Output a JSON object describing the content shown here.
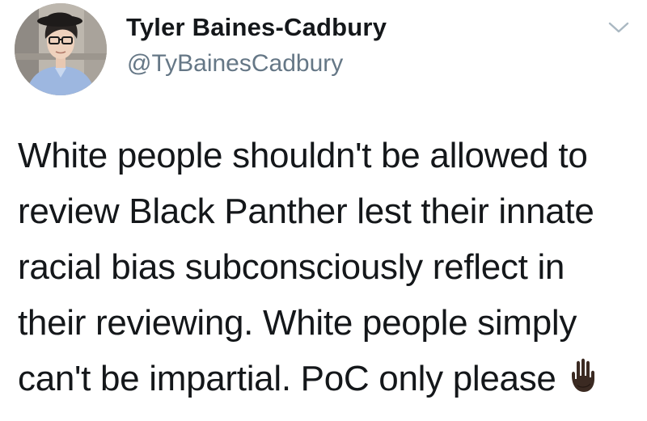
{
  "tweet": {
    "author_name": "Tyler Baines-Cadbury",
    "author_handle": "@TyBainesCadbury",
    "menu_icon": "chevron-down-icon",
    "avatar_icon": "profile-photo",
    "body_lines": [
      "White people shouldn't be allowed to",
      "review Black Panther lest their innate",
      "racial bias subconsciously reflect in",
      "their reviewing. White people simply",
      "can't be impartial. PoC only please"
    ],
    "emoji": "raised-hand-dark-skin-tone",
    "colors": {
      "text": "#14171a",
      "handle": "#657786",
      "chevron": "#aab8c2"
    }
  }
}
